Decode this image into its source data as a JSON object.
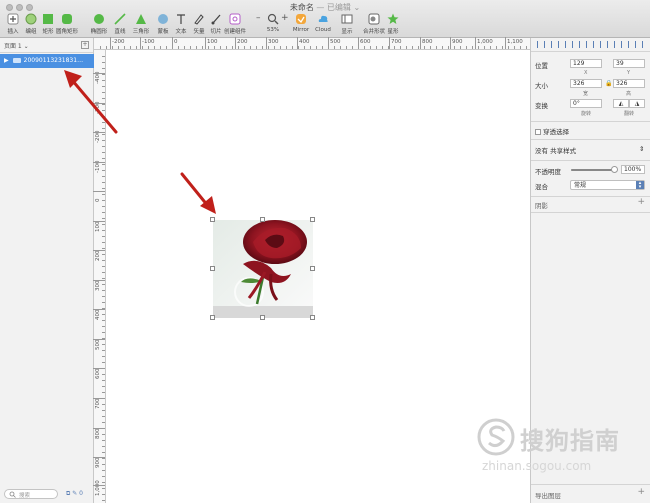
{
  "window": {
    "title": "未命名",
    "subtitle": "— 已编辑 ⌄"
  },
  "toolbar": [
    {
      "name": "insert",
      "label": "插入",
      "icon": "plus-icon"
    },
    {
      "name": "group",
      "label": "编组",
      "icon": "group-icon"
    },
    {
      "name": "rectangle",
      "label": "矩形",
      "icon": "rectangle-icon"
    },
    {
      "name": "rounded-rect",
      "label": "圆角矩形",
      "icon": "rounded-rect-icon"
    },
    {
      "name": "oval",
      "label": "椭圆形",
      "icon": "oval-icon"
    },
    {
      "name": "line",
      "label": "直线",
      "icon": "line-icon"
    },
    {
      "name": "triangle",
      "label": "三角形",
      "icon": "triangle-icon"
    },
    {
      "name": "mask",
      "label": "蒙板",
      "icon": "mask-icon"
    },
    {
      "name": "text",
      "label": "文本",
      "icon": "text-icon"
    },
    {
      "name": "vector",
      "label": "矢量",
      "icon": "vector-icon"
    },
    {
      "name": "slice",
      "label": "切片",
      "icon": "slice-icon"
    },
    {
      "name": "create-symbol",
      "label": "创建组件",
      "icon": "symbol-icon"
    },
    {
      "name": "zoom",
      "label": "53%",
      "icon": "zoom-icon"
    },
    {
      "name": "mirror",
      "label": "Mirror",
      "icon": "mirror-icon"
    },
    {
      "name": "cloud",
      "label": "Cloud",
      "icon": "cloud-icon"
    },
    {
      "name": "view",
      "label": "显示",
      "icon": "view-icon"
    },
    {
      "name": "combine",
      "label": "合并形状",
      "icon": "combine-icon"
    },
    {
      "name": "star",
      "label": "星形",
      "icon": "star-icon"
    }
  ],
  "zoom_minus": "–",
  "zoom_plus": "+",
  "pages": {
    "label": "页面 1 ⌄",
    "add": "+"
  },
  "layers": [
    {
      "name": "20090113231831…"
    }
  ],
  "search": {
    "placeholder": "搜索"
  },
  "bottom_icons": "⧉ ✎ 0",
  "ruler": {
    "h": [
      "-200",
      "-100",
      "0",
      "100",
      "200",
      "300",
      "400",
      "500",
      "600",
      "700",
      "800",
      "900",
      "1,000",
      "1,100"
    ],
    "v": [
      "-400",
      "-300",
      "-200",
      "-100",
      "0",
      "100",
      "200",
      "300",
      "400",
      "500",
      "600",
      "700",
      "800",
      "900",
      "1,000"
    ]
  },
  "inspector": {
    "position": {
      "label": "位置",
      "x": "129",
      "y": "39",
      "x_cap": "X",
      "y_cap": "Y"
    },
    "size": {
      "label": "大小",
      "w": "326",
      "h": "326",
      "w_cap": "宽",
      "h_cap": "高",
      "lock": "🔒"
    },
    "transform": {
      "label": "变换",
      "rotate": "0°",
      "rotate_cap": "旋转",
      "flip_cap": "翻转",
      "flip_h": "◭",
      "flip_v": "◮"
    },
    "clip": "穿透选择",
    "shared_style": "没有 共享样式",
    "opacity": {
      "label": "不透明度",
      "value": "100%",
      "level": 1.0
    },
    "blend": {
      "label": "混合",
      "value": "常规"
    },
    "shadow": "阴影",
    "export": "导出图层"
  },
  "watermark": {
    "cn": "搜狗指南",
    "url": "zhinan.sogou.com"
  },
  "colors": {
    "accent": "#4a90e2",
    "arrow": "#c0201a",
    "rose": "#8e1420"
  }
}
